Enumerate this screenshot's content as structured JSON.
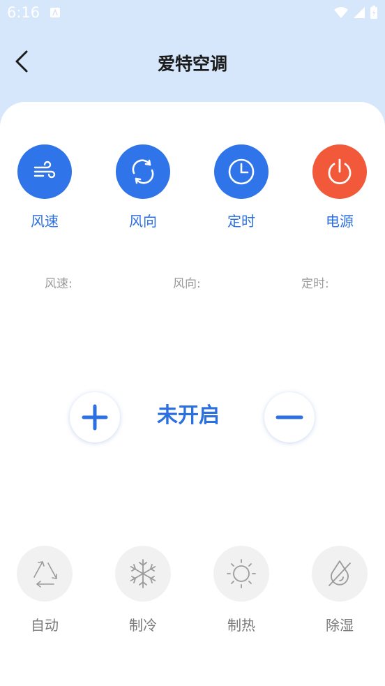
{
  "status_bar": {
    "time": "6:16"
  },
  "header": {
    "title": "爱特空调"
  },
  "controls": [
    {
      "label": "风速",
      "icon": "wind-icon",
      "color": "#2f74e8"
    },
    {
      "label": "风向",
      "icon": "refresh-icon",
      "color": "#2f74e8"
    },
    {
      "label": "定时",
      "icon": "clock-icon",
      "color": "#2f74e8"
    },
    {
      "label": "电源",
      "icon": "power-icon",
      "color": "#f2593a"
    }
  ],
  "info": {
    "speed_label": "风速:",
    "direction_label": "风向:",
    "timer_label": "定时:"
  },
  "main": {
    "status": "未开启"
  },
  "modes": [
    {
      "label": "自动",
      "icon": "recycle-icon"
    },
    {
      "label": "制冷",
      "icon": "snowflake-icon"
    },
    {
      "label": "制热",
      "icon": "sun-icon"
    },
    {
      "label": "除湿",
      "icon": "drop-icon"
    }
  ]
}
